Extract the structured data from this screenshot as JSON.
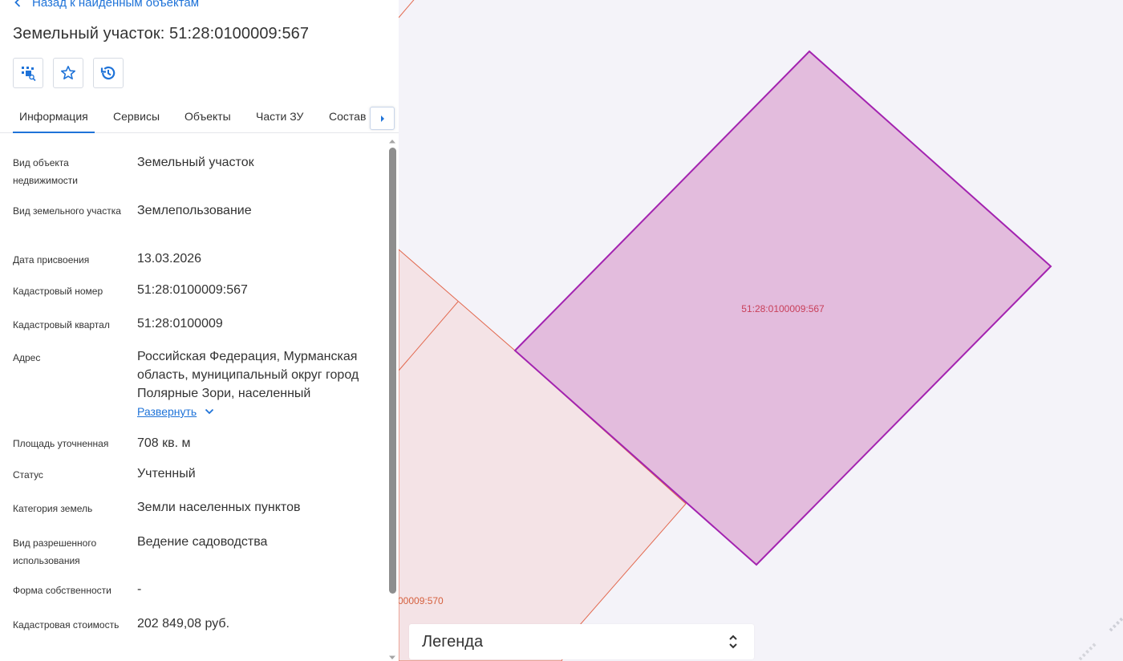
{
  "panel": {
    "back_label": "Назад к найденным объектам",
    "title": "Земельный участок: 51:28:0100009:567",
    "actions": [
      {
        "icon": "select-on-map-icon"
      },
      {
        "icon": "star-icon"
      },
      {
        "icon": "history-icon"
      }
    ],
    "tabs": [
      "Информация",
      "Сервисы",
      "Объекты",
      "Части ЗУ",
      "Состав"
    ],
    "active_tab": "Информация",
    "fields": [
      {
        "label": "Вид объекта недвижимости",
        "value": "Земельный участок"
      },
      {
        "label": "Вид земельного участка",
        "value": "Землепользование"
      },
      {
        "label": "Дата присвоения",
        "value": "13.03.2026"
      },
      {
        "label": "Кадастровый номер",
        "value": "51:28:0100009:567"
      },
      {
        "label": "Кадастровый квартал",
        "value": "51:28:0100009"
      },
      {
        "label": "Адрес",
        "value": "Российская Федерация, Мурманская область, муниципальный округ город Полярные Зори, населенный"
      },
      {
        "label": "Площадь уточненная",
        "value": "708 кв. м"
      },
      {
        "label": "Статус",
        "value": "Учтенный"
      },
      {
        "label": "Категория земель",
        "value": "Земли населенных пунктов"
      },
      {
        "label": "Вид разрешенного использования",
        "value": "Ведение садоводства"
      },
      {
        "label": "Форма собственности",
        "value": "-"
      },
      {
        "label": "Кадастровая стоимость",
        "value": "202 849,08 руб."
      }
    ],
    "expand_label": "Развернуть"
  },
  "map": {
    "selected_parcel_label": "51:28:0100009:567",
    "neighbor_parcel_label": "00009:570",
    "colors": {
      "background": "#f4f3f9",
      "selected_fill": "#e3bcdd",
      "selected_stroke": "#a323b0",
      "neighbor_fill": "#f4e3e6",
      "neighbor_stroke": "#e2694f",
      "label_text": "#c8405a"
    }
  },
  "legend": {
    "title": "Легенда"
  },
  "colors": {
    "accent": "#1f73d8",
    "text": "#333333"
  }
}
